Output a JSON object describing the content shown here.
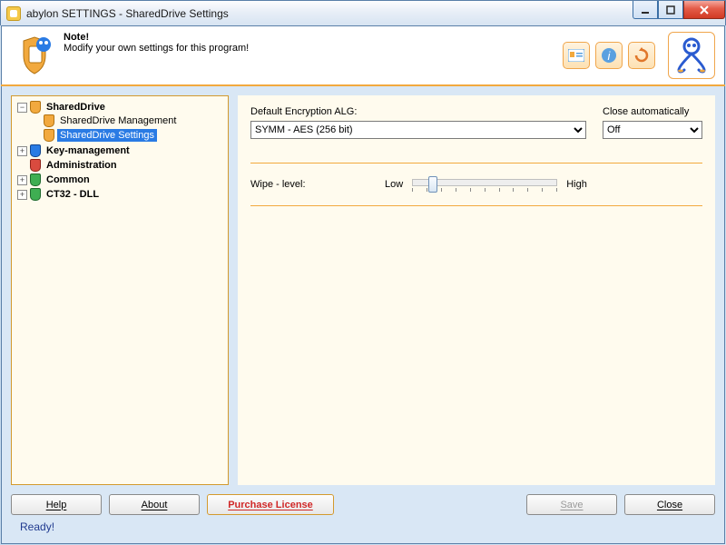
{
  "window": {
    "title": "abylon SETTINGS - SharedDrive Settings"
  },
  "header": {
    "note_title": "Note!",
    "note_text": "Modify your own settings for this program!"
  },
  "tree": {
    "items": [
      {
        "label": "SharedDrive"
      },
      {
        "label": "SharedDrive Management"
      },
      {
        "label": "SharedDrive Settings"
      },
      {
        "label": "Key-management"
      },
      {
        "label": "Administration"
      },
      {
        "label": "Common"
      },
      {
        "label": "CT32 - DLL"
      }
    ]
  },
  "settings": {
    "encryption_label": "Default Encryption ALG:",
    "encryption_value": "SYMM - AES (256 bit)",
    "close_auto_label": "Close automatically",
    "close_auto_value": "Off",
    "wipe_label": "Wipe - level:",
    "wipe_low": "Low",
    "wipe_high": "High"
  },
  "footer": {
    "help": "Help",
    "about": "About",
    "purchase": "Purchase License",
    "save": "Save",
    "close": "Close"
  },
  "status": "Ready!"
}
